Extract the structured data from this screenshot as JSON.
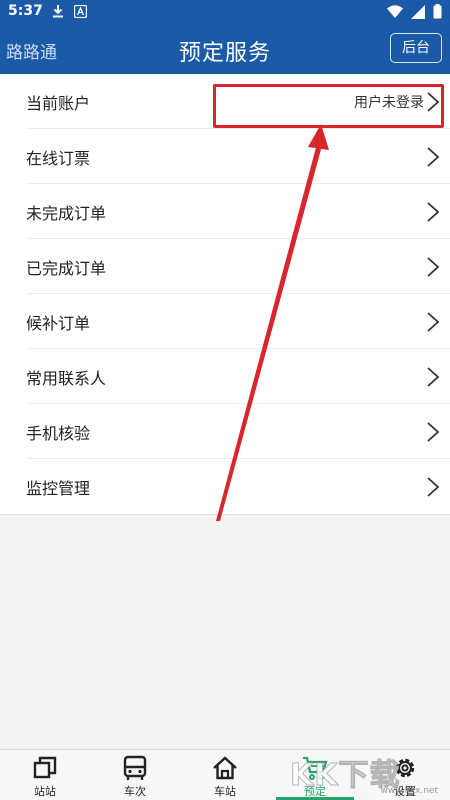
{
  "status_bar": {
    "time": "5:37"
  },
  "app_bar": {
    "app_name": "路路通",
    "title": "预定服务",
    "back_label": "后台"
  },
  "menu": {
    "items": [
      {
        "label": "当前账户",
        "value": "用户未登录"
      },
      {
        "label": "在线订票",
        "value": ""
      },
      {
        "label": "未完成订单",
        "value": ""
      },
      {
        "label": "已完成订单",
        "value": ""
      },
      {
        "label": "候补订单",
        "value": ""
      },
      {
        "label": "常用联系人",
        "value": ""
      },
      {
        "label": "手机核验",
        "value": ""
      },
      {
        "label": "监控管理",
        "value": ""
      }
    ]
  },
  "bottom_nav": {
    "items": [
      {
        "label": "站站",
        "icon": "station-to-station-icon",
        "active": false
      },
      {
        "label": "车次",
        "icon": "bus-icon",
        "active": false
      },
      {
        "label": "车站",
        "icon": "home-icon",
        "active": false
      },
      {
        "label": "预定",
        "icon": "cart-icon",
        "active": true
      },
      {
        "label": "设置",
        "icon": "gear-icon",
        "active": false
      }
    ]
  },
  "watermark": {
    "text": "KK下载",
    "url": "www.kkx.net"
  },
  "colors": {
    "primary": "#1a5aa7",
    "active": "#27a36b",
    "highlight": "#d9252d"
  }
}
